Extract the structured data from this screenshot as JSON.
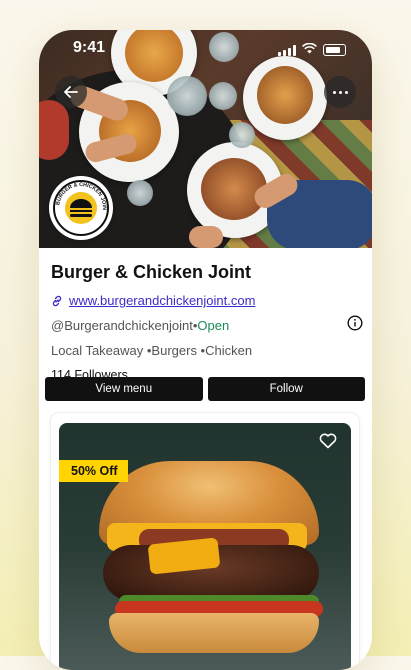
{
  "status_bar": {
    "time": "9:41"
  },
  "restaurant": {
    "name": "Burger & Chicken Joint",
    "website": "www.burgerandchickenjoint.com",
    "handle": "@Burgerandchickenjoint",
    "separator": " •",
    "status": "Open",
    "tags": "Local Takeaway •Burgers •Chicken",
    "followers": "114 Followers",
    "logo_text": "BURGER & CHICKEN JOINT"
  },
  "actions": {
    "view_menu": "View menu",
    "follow": "Follow"
  },
  "promo_card": {
    "badge": "50% Off"
  },
  "colors": {
    "link": "#3b2bc9",
    "open": "#1c8a5a",
    "badge": "#ffd400",
    "button": "#111111"
  },
  "icons": [
    "back-arrow-icon",
    "more-dots-icon",
    "link-icon",
    "info-icon",
    "heart-icon",
    "signal-icon",
    "wifi-icon",
    "battery-icon"
  ]
}
